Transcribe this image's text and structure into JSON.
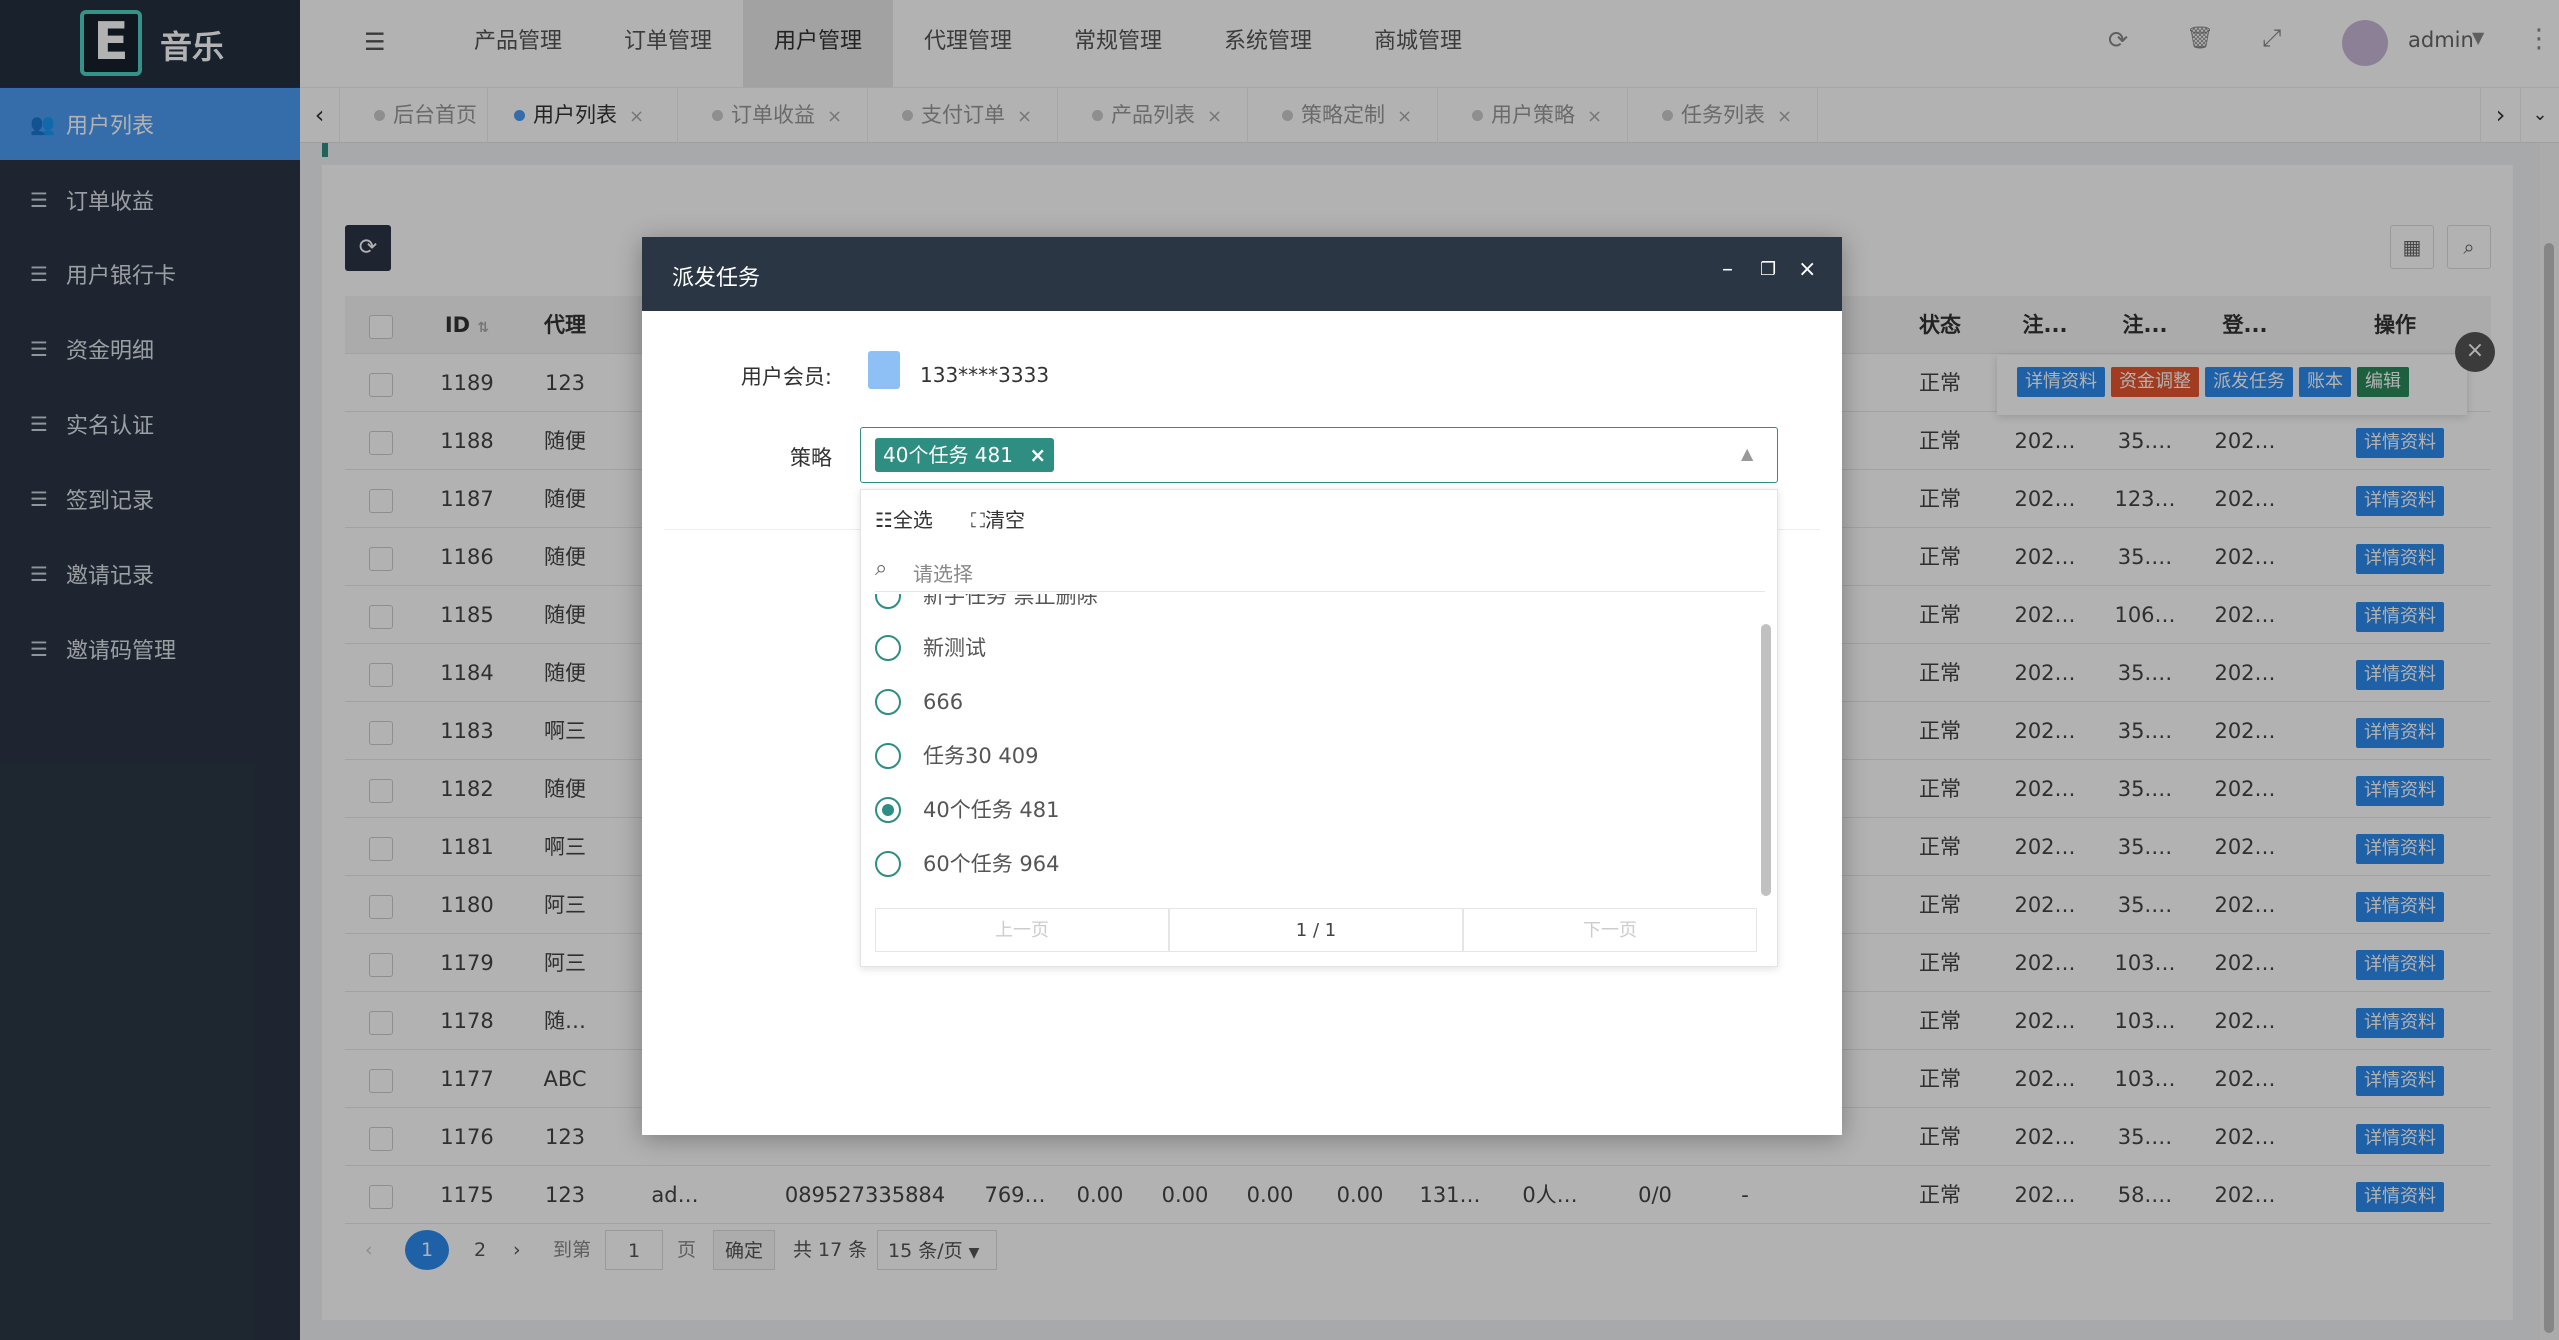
{
  "brand": {
    "logo_letter": "E",
    "name": "音乐"
  },
  "sidebar": {
    "items": [
      {
        "label": "用户列表",
        "active": true
      },
      {
        "label": "订单收益"
      },
      {
        "label": "用户银行卡"
      },
      {
        "label": "资金明细"
      },
      {
        "label": "实名认证"
      },
      {
        "label": "签到记录"
      },
      {
        "label": "邀请记录"
      },
      {
        "label": "邀请码管理"
      }
    ]
  },
  "top_nav": {
    "items": [
      "产品管理",
      "订单管理",
      "用户管理",
      "代理管理",
      "常规管理",
      "系统管理",
      "商城管理"
    ],
    "active_index": 2,
    "user": "admin"
  },
  "tabs": {
    "items": [
      "后台首页",
      "用户列表",
      "订单收益",
      "支付订单",
      "产品列表",
      "策略定制",
      "用户策略",
      "任务列表"
    ],
    "active_index": 1
  },
  "table": {
    "headers": {
      "id": "ID",
      "agent": "代理",
      "status": "状态",
      "reg1": "注...",
      "reg2": "注...",
      "login": "登...",
      "actions": "操作"
    },
    "rows": [
      {
        "id": "1189",
        "agent": "123",
        "status": "正常",
        "reg": "",
        "reg2": "",
        "login": ""
      },
      {
        "id": "1188",
        "agent": "随便",
        "status": "正常",
        "reg": "202…",
        "reg2": "35.…",
        "login": "202…"
      },
      {
        "id": "1187",
        "agent": "随便",
        "status": "正常",
        "reg": "202…",
        "reg2": "123…",
        "login": "202…"
      },
      {
        "id": "1186",
        "agent": "随便",
        "status": "正常",
        "reg": "202…",
        "reg2": "35.…",
        "login": "202…"
      },
      {
        "id": "1185",
        "agent": "随便",
        "status": "正常",
        "reg": "202…",
        "reg2": "106…",
        "login": "202…"
      },
      {
        "id": "1184",
        "agent": "随便",
        "status": "正常",
        "reg": "202…",
        "reg2": "35.…",
        "login": "202…"
      },
      {
        "id": "1183",
        "agent": "啊三",
        "status": "正常",
        "reg": "202…",
        "reg2": "35.…",
        "login": "202…"
      },
      {
        "id": "1182",
        "agent": "随便",
        "status": "正常",
        "reg": "202…",
        "reg2": "35.…",
        "login": "202…"
      },
      {
        "id": "1181",
        "agent": "啊三",
        "status": "正常",
        "reg": "202…",
        "reg2": "35.…",
        "login": "202…"
      },
      {
        "id": "1180",
        "agent": "阿三",
        "status": "正常",
        "reg": "202…",
        "reg2": "35.…",
        "login": "202…"
      },
      {
        "id": "1179",
        "agent": "阿三",
        "status": "正常",
        "reg": "202…",
        "reg2": "103…",
        "login": "202…"
      },
      {
        "id": "1178",
        "agent": "随…",
        "status": "正常",
        "reg": "202…",
        "reg2": "103…",
        "login": "202…"
      },
      {
        "id": "1177",
        "agent": "ABC",
        "status": "正常",
        "reg": "202…",
        "reg2": "103…",
        "login": "202…"
      },
      {
        "id": "1176",
        "agent": "123",
        "status": "正常",
        "reg": "202…",
        "reg2": "35.…",
        "login": "202…"
      },
      {
        "id": "1175",
        "agent": "123",
        "status": "正常",
        "reg": "202…",
        "reg2": "58.…",
        "login": "202…"
      }
    ],
    "last_row_extra": {
      "name": "ad…",
      "phone": "089527335884",
      "c1": "769…",
      "c2": "0.00",
      "c3": "0.00",
      "c4": "0.00",
      "c5": "0.00",
      "c6": "131…",
      "c7": "0人…",
      "c8": "0/0",
      "c9": "-"
    },
    "row_action": "详情资料",
    "hover_actions": [
      "详情资料",
      "资金调整",
      "派发任务",
      "账本",
      "编辑"
    ]
  },
  "pagination": {
    "pages": [
      "1",
      "2"
    ],
    "goto": "到第",
    "page_value": "1",
    "page_unit": "页",
    "confirm": "确定",
    "total": "共 17 条",
    "page_size": "15 条/页"
  },
  "modal": {
    "title": "派发任务",
    "member_label": "用户会员:",
    "member_value": "133****3333",
    "strategy_label": "策略",
    "selected_chip": "40个任务 481",
    "select_all": "全选",
    "clear": "清空",
    "search_placeholder": "请选择",
    "options": [
      {
        "label": "新手任务 禁止删除",
        "selected": false
      },
      {
        "label": "新测试",
        "selected": false
      },
      {
        "label": "666",
        "selected": false
      },
      {
        "label": "任务30 409",
        "selected": false
      },
      {
        "label": "40个任务 481",
        "selected": true
      },
      {
        "label": "60个任务 964",
        "selected": false
      }
    ],
    "prev": "上一页",
    "page": "1 / 1",
    "next": "下一页"
  },
  "colors": {
    "sidebar": "#2b3645",
    "active": "#4c9cf4",
    "teal": "#2f8e82",
    "btn_blue": "#2d8cf0",
    "btn_red": "#e8562f",
    "btn_green": "#2a8a5c"
  }
}
